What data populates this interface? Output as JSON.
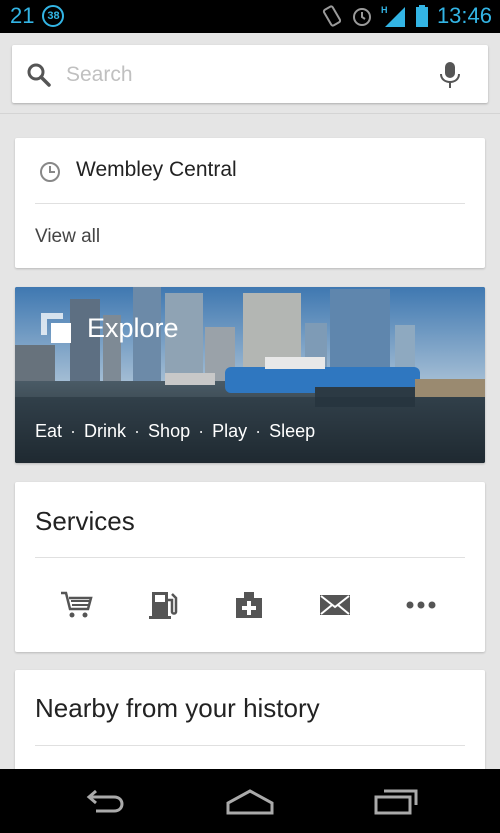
{
  "status_bar": {
    "left_number": "21",
    "badge": "38",
    "network": "H",
    "time": "13:46"
  },
  "search": {
    "placeholder": "Search"
  },
  "recent_card": {
    "item": "Wembley Central",
    "view_all": "View all"
  },
  "explore_card": {
    "title": "Explore",
    "links": [
      "Eat",
      "Drink",
      "Shop",
      "Play",
      "Sleep"
    ],
    "separator": "·"
  },
  "services_card": {
    "title": "Services",
    "items": [
      "shopping-cart-icon",
      "gas-station-icon",
      "pharmacy-icon",
      "mail-icon",
      "more-icon"
    ]
  },
  "nearby_card": {
    "title": "Nearby from your history"
  },
  "colors": {
    "accent": "#33b5e5",
    "icon_gray": "#555555"
  },
  "nav_bar": {
    "buttons": [
      "back-icon",
      "home-icon",
      "recents-icon"
    ]
  }
}
